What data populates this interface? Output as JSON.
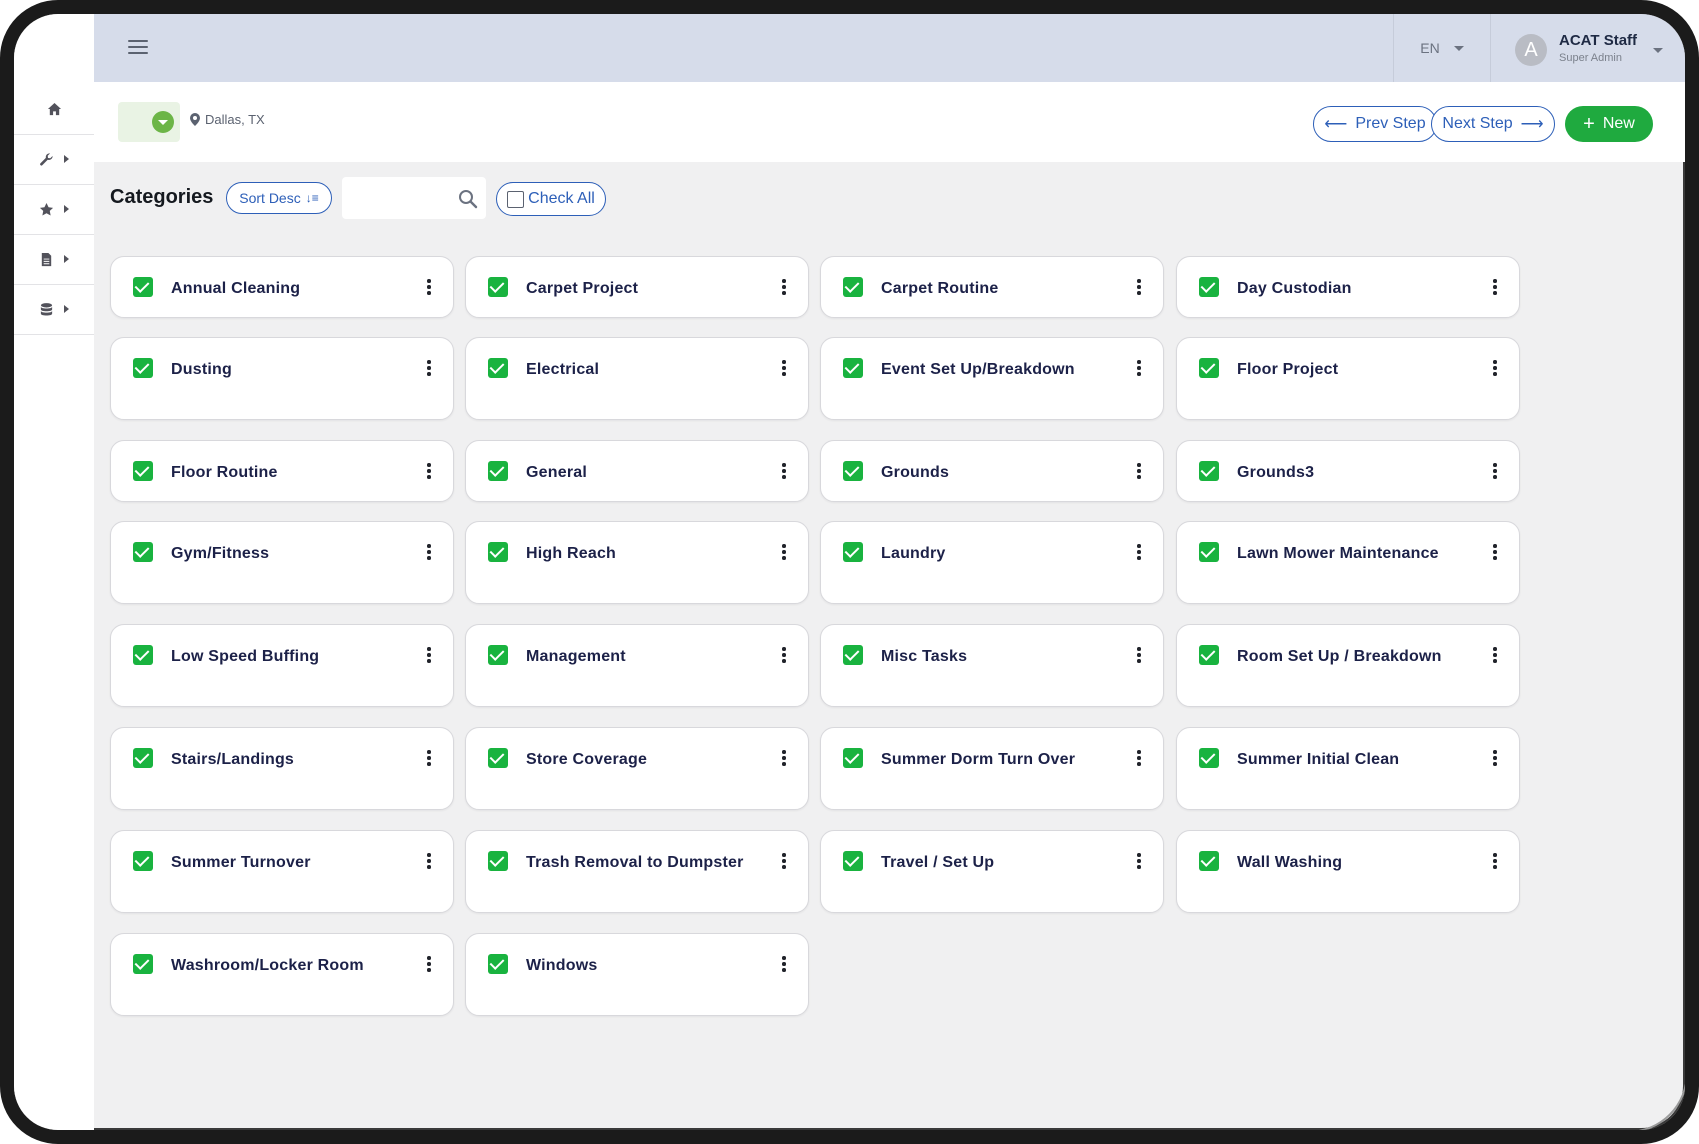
{
  "header": {
    "language": "EN",
    "user": {
      "initial": "A",
      "name": "ACAT Staff",
      "role": "Super Admin"
    }
  },
  "sidebar": {
    "items": [
      {
        "icon": "home-icon"
      },
      {
        "icon": "wrench-icon"
      },
      {
        "icon": "star-icon"
      },
      {
        "icon": "document-icon"
      },
      {
        "icon": "database-icon"
      }
    ]
  },
  "toolbar": {
    "location": "Dallas, TX",
    "prev_label": "Prev Step",
    "next_label": "Next Step",
    "new_label": "New"
  },
  "categories": {
    "title": "Categories",
    "sort_label": "Sort Desc",
    "search_placeholder": "",
    "check_all_label": "Check All",
    "items": [
      {
        "label": "Annual Cleaning",
        "checked": true
      },
      {
        "label": "Carpet Project",
        "checked": true
      },
      {
        "label": "Carpet Routine",
        "checked": true
      },
      {
        "label": "Day Custodian",
        "checked": true
      },
      {
        "label": "Dusting",
        "checked": true
      },
      {
        "label": "Electrical",
        "checked": true
      },
      {
        "label": "Event Set Up/Breakdown",
        "checked": true
      },
      {
        "label": "Floor Project",
        "checked": true
      },
      {
        "label": "Floor Routine",
        "checked": true
      },
      {
        "label": "General",
        "checked": true
      },
      {
        "label": "Grounds",
        "checked": true
      },
      {
        "label": "Grounds3",
        "checked": true
      },
      {
        "label": "Gym/Fitness",
        "checked": true
      },
      {
        "label": "High Reach",
        "checked": true
      },
      {
        "label": "Laundry",
        "checked": true
      },
      {
        "label": "Lawn Mower Maintenance",
        "checked": true
      },
      {
        "label": "Low Speed Buffing",
        "checked": true
      },
      {
        "label": "Management",
        "checked": true
      },
      {
        "label": "Misc Tasks",
        "checked": true
      },
      {
        "label": "Room Set Up / Breakdown",
        "checked": true
      },
      {
        "label": "Stairs/Landings",
        "checked": true
      },
      {
        "label": "Store Coverage",
        "checked": true
      },
      {
        "label": "Summer Dorm Turn Over",
        "checked": true
      },
      {
        "label": "Summer Initial Clean",
        "checked": true
      },
      {
        "label": "Summer Turnover",
        "checked": true
      },
      {
        "label": "Trash Removal to Dumpster",
        "checked": true
      },
      {
        "label": "Travel / Set Up",
        "checked": true
      },
      {
        "label": "Wall Washing",
        "checked": true
      },
      {
        "label": "Washroom/Locker Room",
        "checked": true
      },
      {
        "label": "Windows",
        "checked": true
      }
    ]
  },
  "colors": {
    "accent": "#2d5fb8",
    "primary": "#1faa3f",
    "check": "#19b33f",
    "header": "#d6dcea"
  }
}
